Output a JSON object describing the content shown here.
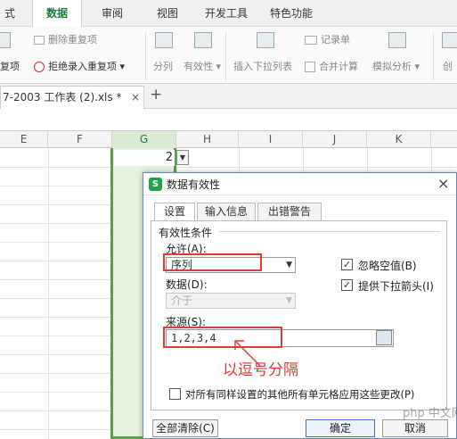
{
  "ribbon_tabs": [
    "式",
    "数据",
    "审阅",
    "视图",
    "开发工具",
    "特色功能"
  ],
  "ribbon": {
    "remove_duplicates": "删除重复项",
    "dup_partial": "复项",
    "reject_duplicates": "拒绝录入重复项",
    "split": "分列",
    "validity": "有效性",
    "insert_dropdown": "插入下拉列表",
    "record_form": "记录单",
    "merge_calc": "合并计算",
    "simulate": "模拟分析",
    "create_partial": "创"
  },
  "doc_tab": {
    "title": "7-2003 工作表 (2).xls *",
    "close": "×",
    "add": "+"
  },
  "columns": [
    "E",
    "F",
    "G",
    "H",
    "I",
    "J",
    "K"
  ],
  "cell_value": "2",
  "dialog": {
    "title": "数据有效性",
    "close": "×",
    "tabs": [
      "设置",
      "输入信息",
      "出错警告"
    ],
    "group_label": "有效性条件",
    "allow_label": "允许(A):",
    "allow_value": "序列",
    "data_label": "数据(D):",
    "data_value": "介于",
    "ignore_blank": "忽略空值(B)",
    "provide_dropdown": "提供下拉箭头(I)",
    "source_label": "来源(S):",
    "source_value": "1,2,3,4",
    "annotation": "以逗号分隔",
    "apply_all": "对所有同样设置的其他所有单元格应用这些更改(P)",
    "clear_all": "全部清除(C)",
    "ok": "确定",
    "cancel": "取消"
  },
  "watermark": "php 中文网",
  "colors": {
    "accent_green": "#1d7b37",
    "annotation_red": "#e03a3a",
    "selection_green": "#5aa04c"
  }
}
